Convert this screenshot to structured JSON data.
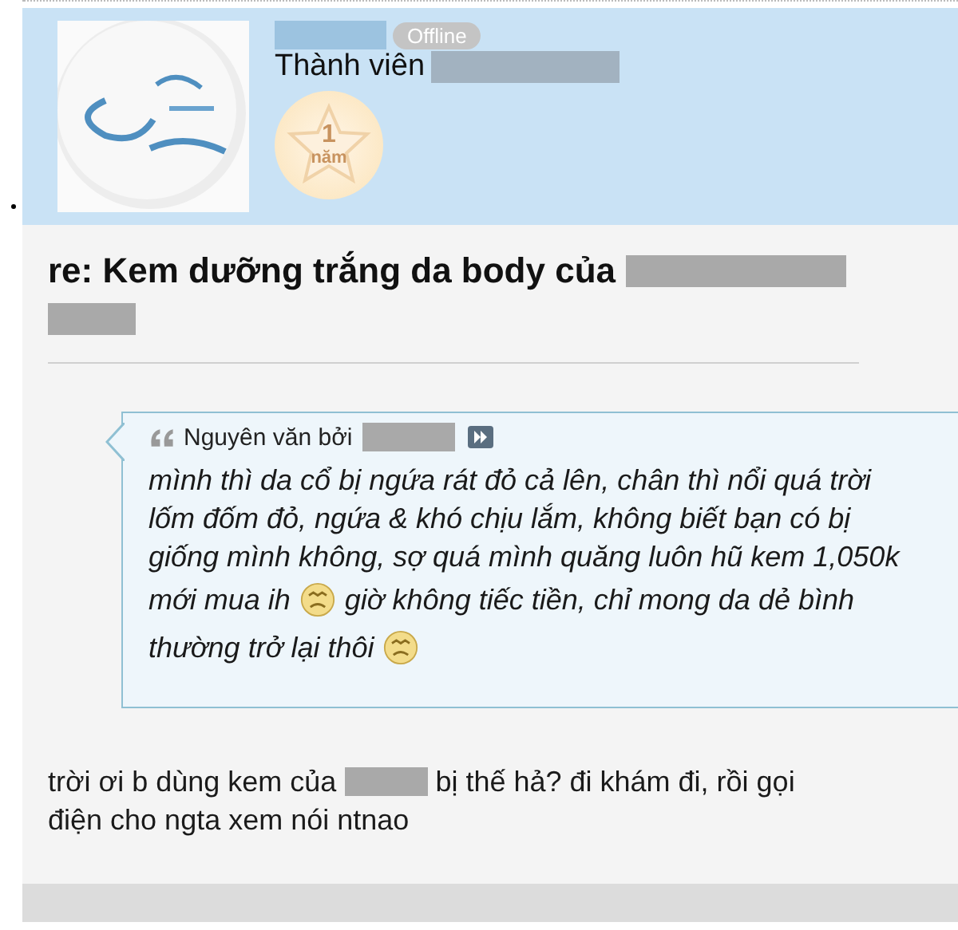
{
  "profile": {
    "status": "Offline",
    "rank_label": "Thành viên",
    "badge": {
      "number": "1",
      "label": "năm"
    }
  },
  "post": {
    "title_lines": [
      [
        {
          "kind": "text",
          "text": "re: Kem dưỡng trắng da body của"
        },
        {
          "kind": "redacted"
        }
      ],
      [
        {
          "kind": "redacted"
        }
      ]
    ],
    "quote": {
      "header": "Nguyên văn bởi",
      "lines": [
        [
          {
            "kind": "text",
            "text": "mình thì da cổ bị ngứa rát đỏ cả lên, chân thì nổi quá trời"
          }
        ],
        [
          {
            "kind": "text",
            "text": "lốm đốm đỏ, ngứa & khó chịu lắm, không biết bạn có bị"
          }
        ],
        [
          {
            "kind": "text",
            "text": "giống mình không, sợ quá mình quăng luôn hũ kem 1,050k"
          }
        ],
        [
          {
            "kind": "text",
            "text": "mới mua ih"
          },
          {
            "kind": "emoticon"
          },
          {
            "kind": "text",
            "text": "giờ không tiếc tiền, chỉ mong da dẻ bình"
          }
        ],
        [
          {
            "kind": "text",
            "text": "thường trở lại thôi"
          },
          {
            "kind": "emoticon"
          }
        ]
      ]
    },
    "reply_lines": [
      [
        {
          "kind": "text",
          "text": "trời ơi b dùng kem của"
        },
        {
          "kind": "redacted"
        },
        {
          "kind": "text",
          "text": "bị thế hả? đi khám đi, rồi gọi"
        }
      ],
      [
        {
          "kind": "text",
          "text": "điện cho ngta xem nói ntnao"
        }
      ]
    ]
  }
}
